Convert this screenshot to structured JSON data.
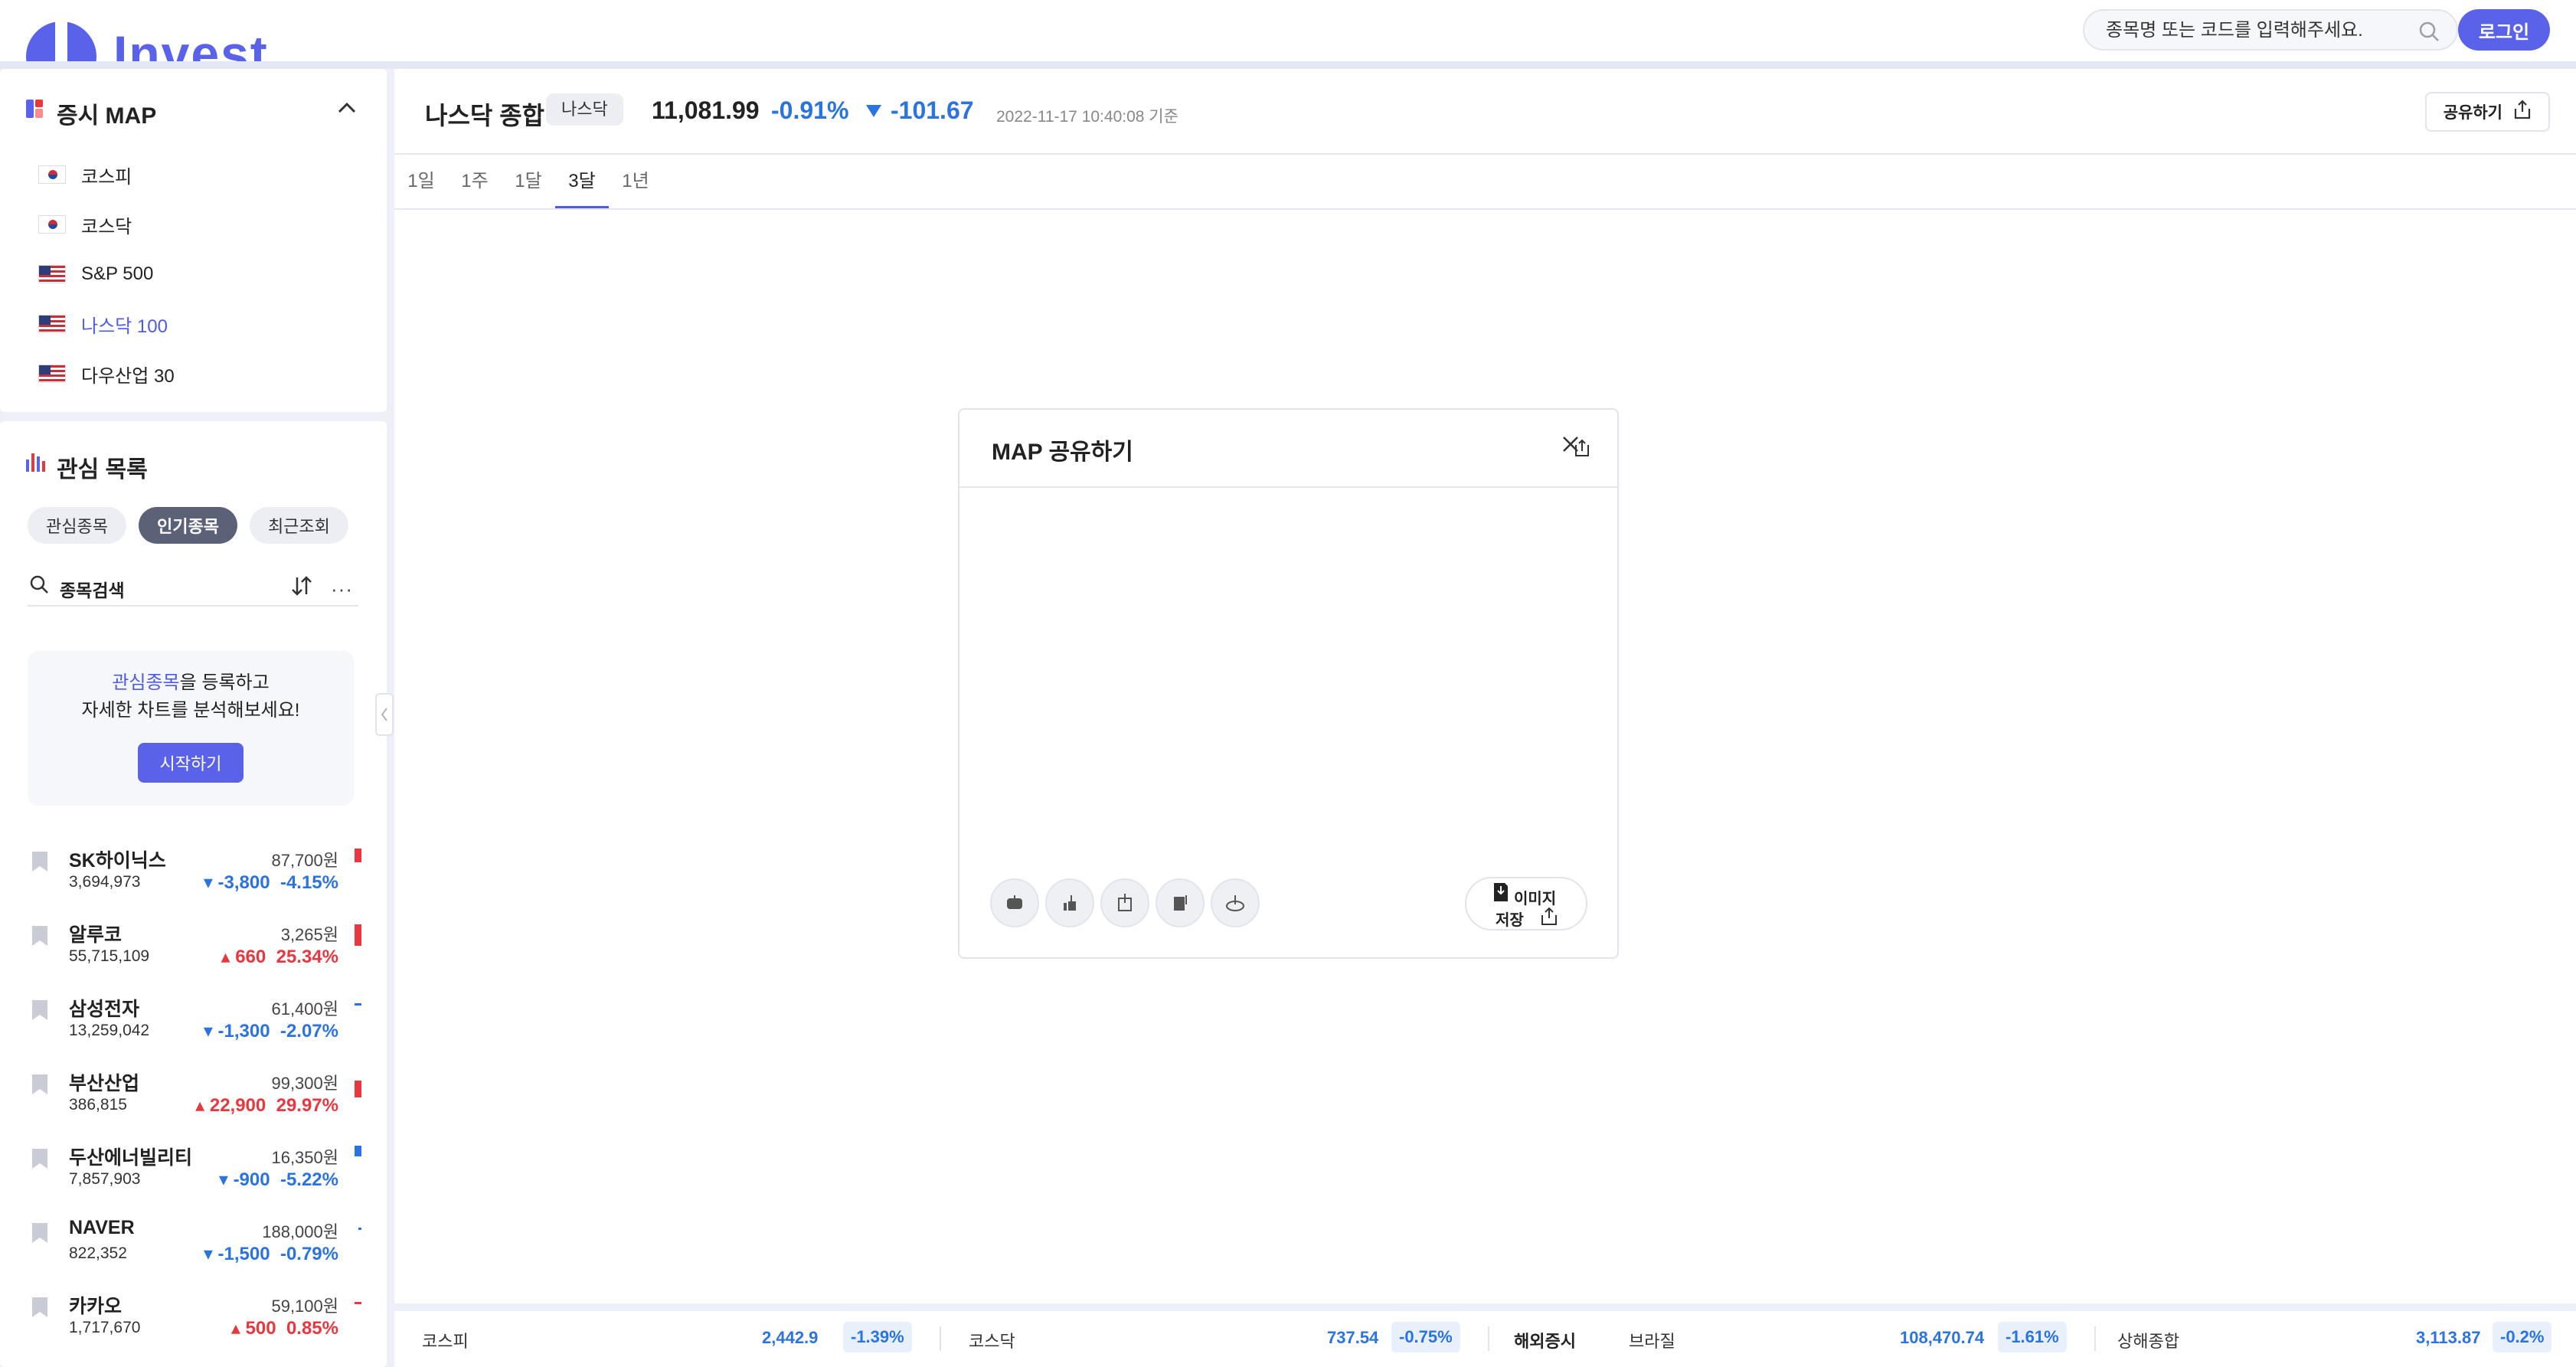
{
  "header": {
    "logo_text": "Invest",
    "search_placeholder": "종목명 또는 코드를 입력해주세요.",
    "login_label": "로그인"
  },
  "market_map": {
    "title": "증시 MAP",
    "items": [
      {
        "label": "코스피",
        "flag": "kr-flag"
      },
      {
        "label": "코스닥",
        "flag": "kr-flag"
      },
      {
        "label": "S&P 500",
        "flag": "us-flag"
      },
      {
        "label": "나스닥 100",
        "flag": "us-flag",
        "active": true
      },
      {
        "label": "다우산업 30",
        "flag": "us-flag"
      }
    ]
  },
  "watchlist": {
    "title": "관심 목록",
    "tabs": [
      "관심종목",
      "인기종목",
      "최근조회"
    ],
    "active_tab": "인기종목",
    "search_label": "종목검색",
    "more_glyph": "···",
    "promo": {
      "highlight": "관심종목",
      "line1_rest": "을 등록하고",
      "line2": "자세한 차트를 분석해보세요!",
      "button": "시작하기"
    },
    "stocks": [
      {
        "name": "SK하이닉스",
        "volume": "3,694,973",
        "price": "87,700원",
        "change": "-3,800",
        "pct": "-4.15%",
        "dir": "down"
      },
      {
        "name": "알루코",
        "volume": "55,715,109",
        "price": "3,265원",
        "change": "660",
        "pct": "25.34%",
        "dir": "up"
      },
      {
        "name": "삼성전자",
        "volume": "13,259,042",
        "price": "61,400원",
        "change": "-1,300",
        "pct": "-2.07%",
        "dir": "down"
      },
      {
        "name": "부산산업",
        "volume": "386,815",
        "price": "99,300원",
        "change": "22,900",
        "pct": "29.97%",
        "dir": "up"
      },
      {
        "name": "두산에너빌리티",
        "volume": "7,857,903",
        "price": "16,350원",
        "change": "-900",
        "pct": "-5.22%",
        "dir": "down"
      },
      {
        "name": "NAVER",
        "volume": "822,352",
        "price": "188,000원",
        "change": "-1,500",
        "pct": "-0.79%",
        "dir": "down"
      },
      {
        "name": "카카오",
        "volume": "1,717,670",
        "price": "59,100원",
        "change": "500",
        "pct": "0.85%",
        "dir": "up"
      }
    ]
  },
  "main": {
    "index_name": "나스닥 종합",
    "badge": "나스닥",
    "value": "11,081.99",
    "pct": "-0.91%",
    "change": "-101.67",
    "timestamp": "2022-11-17 10:40:08 기준",
    "share_label": "공유하기",
    "periods": [
      "1일",
      "1주",
      "1달",
      "3달",
      "1년"
    ],
    "active_period": "3달"
  },
  "modal": {
    "title": "MAP 공유하기",
    "sns_icons": [
      "kakaotalk-icon",
      "facebook-icon",
      "twitter-icon",
      "band-icon",
      "link-icon"
    ],
    "save_line1": "이미지",
    "save_line2": "저장"
  },
  "ticker": [
    {
      "label": "코스피",
      "value": "2,442.9",
      "pct": "-1.39%"
    },
    {
      "label": "코스닥",
      "value": "737.54",
      "pct": "-0.75%"
    },
    {
      "section": "해외증시",
      "label": "브라질",
      "value": "108,470.74",
      "pct": "-1.61%"
    },
    {
      "label": "상해종합",
      "value": "3,113.87",
      "pct": "-0.2%"
    }
  ],
  "colors": {
    "accent": "#5a62ea",
    "up": "#e8373e",
    "down": "#2a73e0"
  }
}
